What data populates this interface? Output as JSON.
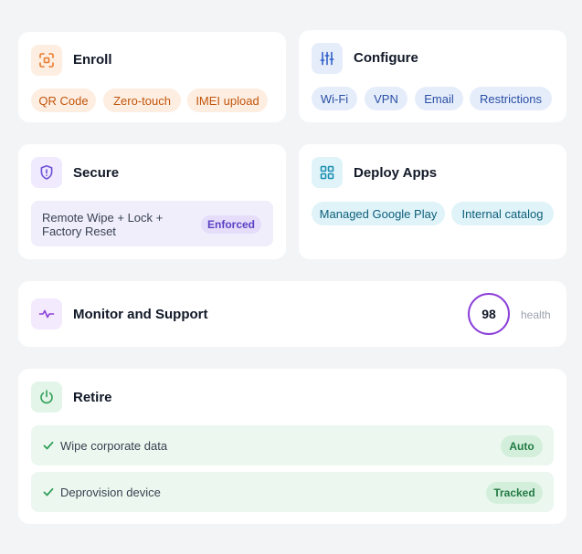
{
  "enroll": {
    "title": "Enroll",
    "icon": "scan-icon",
    "tags": [
      "QR Code",
      "Zero-touch",
      "IMEI upload"
    ],
    "accent": "#ea7a2c"
  },
  "configure": {
    "title": "Configure",
    "icon": "sliders-icon",
    "tags": [
      "Wi-Fi",
      "VPN",
      "Email",
      "Restrictions"
    ],
    "accent": "#2f5fc9"
  },
  "secure": {
    "title": "Secure",
    "icon": "shield-icon",
    "policy_line1": "Remote Wipe + Lock +",
    "policy_line2": "Factory Reset",
    "status": "Enforced",
    "accent": "#6b4fd8"
  },
  "deploy": {
    "title": "Deploy Apps",
    "icon": "grid-icon",
    "tags": [
      "Managed Google Play",
      "Internal catalog"
    ],
    "accent": "#1d8fb0"
  },
  "monitor": {
    "title": "Monitor and Support",
    "icon": "pulse-icon",
    "health_value": "98",
    "health_label": "health",
    "accent": "#8b3fd9"
  },
  "retire": {
    "title": "Retire",
    "icon": "power-icon",
    "accent": "#2f9e58",
    "items": [
      {
        "label": "Wipe corporate data",
        "status": "Auto"
      },
      {
        "label": "Deprovision device",
        "status": "Tracked"
      }
    ]
  }
}
